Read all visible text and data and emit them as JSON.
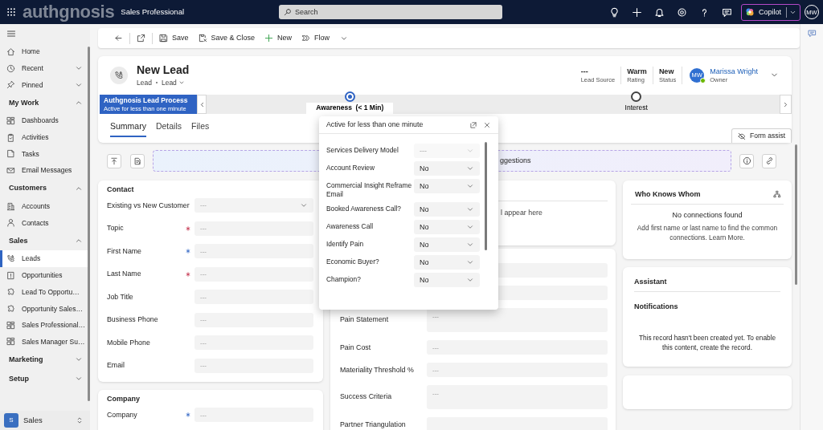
{
  "app_bar": {
    "logo": "authgnosis",
    "app_name": "Sales Professional",
    "search": {
      "placeholder": "Search"
    },
    "copilot": "Copilot",
    "avatar": "MW"
  },
  "sidebar": {
    "items": [
      {
        "label": "Home",
        "selected": false
      },
      {
        "label": "Recent",
        "selected": false,
        "expanded": false
      },
      {
        "label": "Pinned",
        "selected": false,
        "expanded": false
      }
    ],
    "groups": [
      {
        "label": "My Work",
        "expanded": true,
        "items": [
          {
            "label": "Dashboards",
            "selected": false
          },
          {
            "label": "Activities",
            "selected": false
          },
          {
            "label": "Tasks",
            "selected": false
          },
          {
            "label": "Email Messages",
            "selected": false
          }
        ]
      },
      {
        "label": "Customers",
        "expanded": true,
        "items": [
          {
            "label": "Accounts",
            "selected": false
          },
          {
            "label": "Contacts",
            "selected": false
          }
        ]
      },
      {
        "label": "Sales",
        "expanded": true,
        "items": [
          {
            "label": "Leads",
            "selected": true
          },
          {
            "label": "Opportunities",
            "selected": false
          },
          {
            "label": "Lead To Opportu…",
            "selected": false
          },
          {
            "label": "Opportunity Sales…",
            "selected": false
          },
          {
            "label": "Sales Professional…",
            "selected": false
          },
          {
            "label": "Sales Manager Su…",
            "selected": false
          }
        ]
      },
      {
        "label": "Marketing",
        "expanded": false
      },
      {
        "label": "Setup",
        "expanded": false
      }
    ],
    "area_switcher": {
      "badge": "S",
      "label": "Sales"
    }
  },
  "command_bar": {
    "buttons": [
      {
        "kind": "save",
        "label": "Save"
      },
      {
        "kind": "save_close",
        "label": "Save & Close"
      },
      {
        "kind": "new",
        "label": "New"
      },
      {
        "kind": "flow",
        "label": "Flow",
        "dropdown": true
      }
    ]
  },
  "record": {
    "title": "New Lead",
    "entity": "Lead",
    "form": "Lead",
    "header_fields": [
      {
        "value": "---",
        "label": "Lead Source"
      },
      {
        "value": "Warm",
        "label": "Rating"
      },
      {
        "value": "New",
        "label": "Status"
      }
    ],
    "owner": {
      "initials": "MW",
      "name": "Marissa Wright",
      "label": "Owner",
      "online": true
    }
  },
  "process": {
    "name": "Authgnosis Lead Process",
    "status": "Active for less than one minute",
    "stages": [
      {
        "name": "Awareness",
        "duration": "(< 1 Min)",
        "selected": true
      },
      {
        "name": "Interest",
        "selected": false
      }
    ]
  },
  "tabs": [
    {
      "label": "Summary",
      "selected": true
    },
    {
      "label": "Details",
      "selected": false
    },
    {
      "label": "Files",
      "selected": false
    }
  ],
  "form_assist": "Form assist",
  "suggestions_banner": {
    "link": "ggestions"
  },
  "sections": {
    "contact": {
      "title": "Contact",
      "fields": [
        {
          "label": "Existing vs New Customer",
          "kind": "select",
          "placeholder": "---",
          "required": false,
          "recommended": false
        },
        {
          "label": "Topic",
          "kind": "text",
          "placeholder": "---",
          "required": true,
          "recommended": false
        },
        {
          "label": "First Name",
          "kind": "text",
          "placeholder": "---",
          "required": false,
          "recommended": true
        },
        {
          "label": "Last Name",
          "kind": "text",
          "placeholder": "---",
          "required": true,
          "recommended": false
        },
        {
          "label": "Job Title",
          "kind": "text",
          "placeholder": "---",
          "required": false,
          "recommended": false
        },
        {
          "label": "Business Phone",
          "kind": "text",
          "placeholder": "---",
          "required": false,
          "recommended": false
        },
        {
          "label": "Mobile Phone",
          "kind": "text",
          "placeholder": "---",
          "required": false,
          "recommended": false
        },
        {
          "label": "Email",
          "kind": "text",
          "placeholder": "---",
          "required": false,
          "recommended": false
        }
      ]
    },
    "company": {
      "title": "Company",
      "fields": [
        {
          "label": "Company",
          "kind": "text",
          "placeholder": "---",
          "required": false,
          "recommended": true
        }
      ]
    },
    "middle_top": {
      "text": "l appear here"
    },
    "middle": {
      "fields": [
        {
          "kind": "text"
        },
        {
          "kind": "text"
        },
        {
          "label": "Pain Statement",
          "kind": "textarea",
          "placeholder": "---"
        },
        {
          "label": "Pain Cost",
          "kind": "text",
          "placeholder": "---"
        },
        {
          "label": "Materiality Threshold %",
          "kind": "text",
          "placeholder": "---"
        },
        {
          "label": "Success Criteria",
          "kind": "textarea",
          "placeholder": "---"
        },
        {
          "label": "Partner Triangulation",
          "kind": "text"
        }
      ]
    },
    "who_knows_whom": {
      "title": "Who Knows Whom",
      "empty_title": "No connections found",
      "message": "Add first name or last name to find the common connections.",
      "link": "Learn More."
    },
    "assistant": {
      "title": "Assistant",
      "subtitle": "Notifications",
      "message": "This record hasn't been created yet. To enable this content, create the record."
    }
  },
  "stage_flyout": {
    "title": "Active for less than one minute",
    "fields": [
      {
        "label": "Services Delivery Model",
        "placeholder": "---",
        "disabled": true
      },
      {
        "label": "Account Review",
        "value": "No",
        "disabled": false
      },
      {
        "label": "Commercial Insight Reframe Email",
        "value": "No",
        "disabled": false
      },
      {
        "label": "Booked Awareness Call?",
        "value": "No",
        "disabled": false
      },
      {
        "label": "Awareness Call",
        "value": "No",
        "disabled": false
      },
      {
        "label": "Identify Pain",
        "value": "No",
        "disabled": false
      },
      {
        "label": "Economic Buyer?",
        "value": "No",
        "disabled": false
      },
      {
        "label": "Champion?",
        "value": "No",
        "disabled": false
      }
    ]
  }
}
